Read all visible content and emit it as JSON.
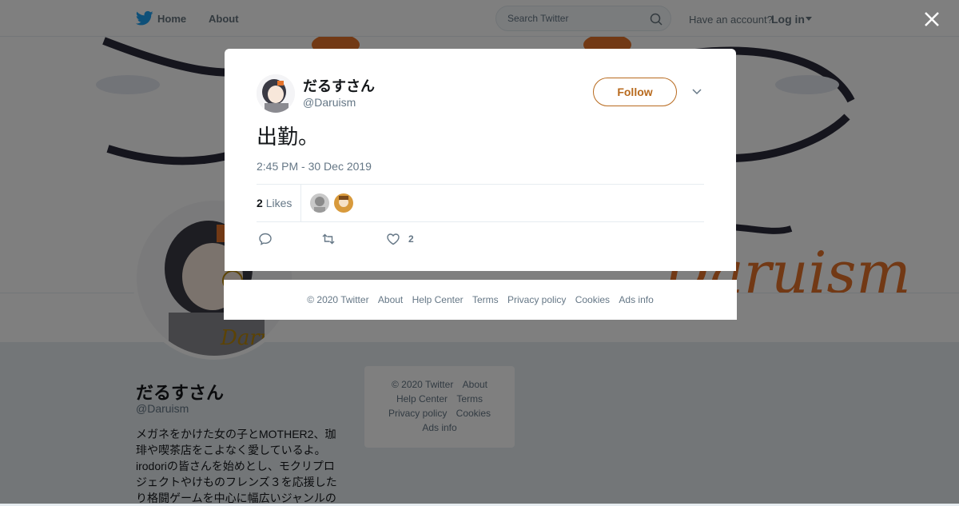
{
  "topbar": {
    "home_label": "Home",
    "about_label": "About",
    "search_placeholder": "Search Twitter",
    "have_account": "Have an account?",
    "login_label": "Log in",
    "brand_color": "#1da1f2"
  },
  "profile": {
    "name": "だるすさん",
    "handle": "@Daruism",
    "bio": "メガネをかけた女の子とMOTHER2、珈琲や喫茶店をこよなく愛しているよ。irodoriの皆さんを始めとし、モクリプロジェクトやけものフレンズ３を応援したり格闘ゲームを中心に幅広いジャンルの",
    "banner_text": "Daruism",
    "accent_color": "#e5732b"
  },
  "background_footer": {
    "row1": [
      "© 2020 Twitter",
      "About"
    ],
    "row2": [
      "Help Center",
      "Terms"
    ],
    "row3": [
      "Privacy policy",
      "Cookies"
    ],
    "row4": [
      "Ads info"
    ]
  },
  "tweet": {
    "author_name": "だるすさん",
    "author_handle": "@Daruism",
    "follow_label": "Follow",
    "follow_color": "#b86a1e",
    "text": "出勤。",
    "timestamp": "2:45 PM - 30 Dec 2019",
    "likes_count": "2",
    "likes_label": "Likes",
    "like_action_count": "2"
  },
  "modal_footer": [
    "© 2020 Twitter",
    "About",
    "Help Center",
    "Terms",
    "Privacy policy",
    "Cookies",
    "Ads info"
  ],
  "icons": [
    "twitter-bird-icon",
    "search-icon",
    "caret-down-icon",
    "close-icon",
    "chevron-down-icon",
    "reply-icon",
    "retweet-icon",
    "heart-icon"
  ]
}
